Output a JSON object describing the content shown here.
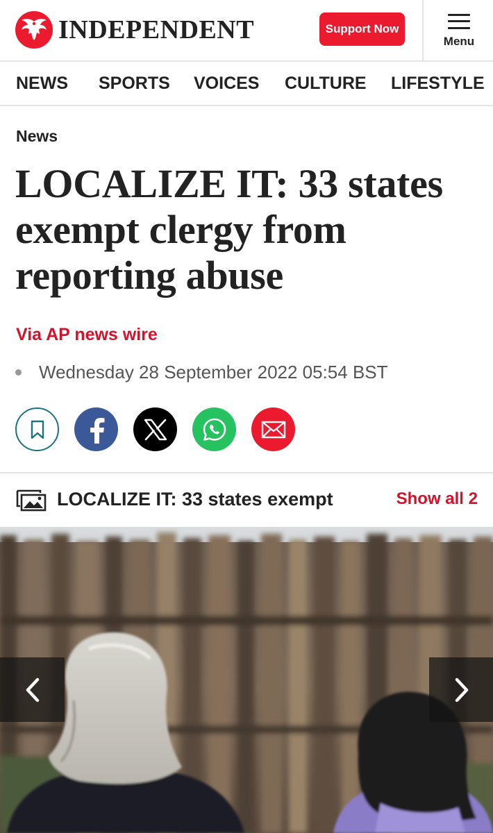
{
  "header": {
    "brand_name": "INDEPENDENT",
    "brand_logo": "eagle-logo",
    "support_label": "Support Now",
    "menu_label": "Menu",
    "accent_color": "#ec1a2e"
  },
  "nav": {
    "items": [
      {
        "label": "NEWS"
      },
      {
        "label": "SPORTS"
      },
      {
        "label": "VOICES"
      },
      {
        "label": "CULTURE"
      },
      {
        "label": "LIFESTYLE"
      }
    ]
  },
  "article": {
    "section": "News",
    "headline": "LOCALIZE IT: 33 states exempt clergy from reporting abuse",
    "byline": "Via AP news wire",
    "date": "Wednesday 28 September 2022 05:54 BST"
  },
  "share": {
    "icons": [
      "bookmark-icon",
      "facebook-icon",
      "x-icon",
      "whatsapp-icon",
      "email-icon"
    ]
  },
  "gallery": {
    "title": "LOCALIZE IT: 33 states exempt",
    "show_all_label": "Show all 2",
    "prev_icon": "chevron-left-icon",
    "next_icon": "chevron-right-icon"
  }
}
